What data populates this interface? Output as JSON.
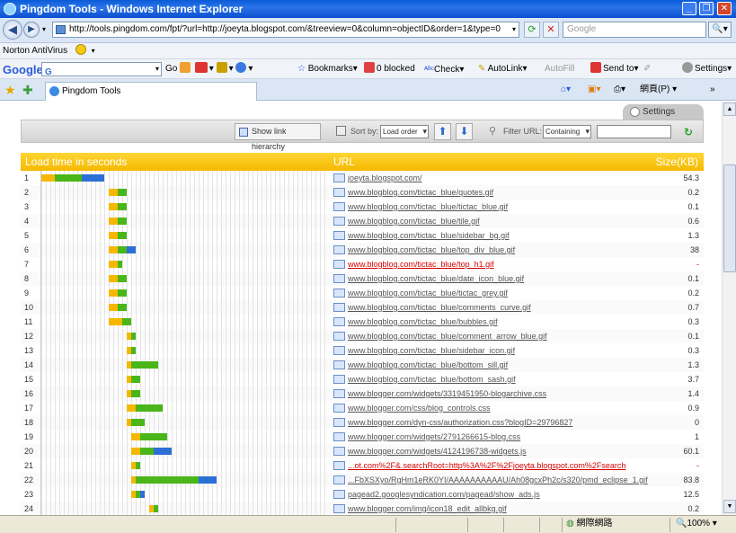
{
  "window": {
    "title": "Pingdom Tools - Windows Internet Explorer"
  },
  "nav": {
    "address": "http://tools.pingdom.com/fpt/?url=http://joeyta.blogspot.com/&treeview=0&column=objectID&order=1&type=0",
    "search_placeholder": "Google"
  },
  "norton": {
    "label": "Norton AntiVirus"
  },
  "google_toolbar": {
    "logo": "Google",
    "search_value": "G",
    "go_label": "Go",
    "bookmarks_label": "Bookmarks",
    "blocked_label": "0 blocked",
    "check_label": "Check",
    "autolink_label": "AutoLink",
    "autofill_label": "AutoFill",
    "sendto_label": "Send to",
    "settings_label": "Settings"
  },
  "tab": {
    "label": "Pingdom Tools",
    "page_label": "網頁(P)"
  },
  "tool": {
    "settings_label": "Settings",
    "hierarchy_label": "Show link hierarchy",
    "sortby_label": "Sort by:",
    "sort_value": "Load order",
    "filter_label": "Filter URL:",
    "filter_mode": "Containing"
  },
  "table": {
    "col_load": "Load time in seconds",
    "col_url": "URL",
    "col_size": "Size(KB)",
    "rows": [
      {
        "n": "1",
        "url": "joeyta.blogspot.com/",
        "size": "54.3",
        "err": false,
        "bars": [
          [
            0,
            3,
            "#f5b800"
          ],
          [
            3,
            9,
            "#4ab61a"
          ],
          [
            9,
            14,
            "#2c6fd6"
          ]
        ]
      },
      {
        "n": "2",
        "url": "www.blogblog.com/tictac_blue/quotes.gif",
        "size": "0.2",
        "err": false,
        "bars": [
          [
            15,
            17,
            "#f5b800"
          ],
          [
            17,
            19,
            "#4ab61a"
          ]
        ]
      },
      {
        "n": "3",
        "url": "www.blogblog.com/tictac_blue/tictac_blue.gif",
        "size": "0.1",
        "err": false,
        "bars": [
          [
            15,
            17,
            "#f5b800"
          ],
          [
            17,
            19,
            "#4ab61a"
          ]
        ]
      },
      {
        "n": "4",
        "url": "www.blogblog.com/tictac_blue/tile.gif",
        "size": "0.6",
        "err": false,
        "bars": [
          [
            15,
            17,
            "#f5b800"
          ],
          [
            17,
            19,
            "#4ab61a"
          ]
        ]
      },
      {
        "n": "5",
        "url": "www.blogblog.com/tictac_blue/sidebar_bg.gif",
        "size": "1.3",
        "err": false,
        "bars": [
          [
            15,
            17,
            "#f5b800"
          ],
          [
            17,
            19,
            "#4ab61a"
          ]
        ]
      },
      {
        "n": "6",
        "url": "www.blogblog.com/tictac_blue/top_div_blue.gif",
        "size": "38",
        "err": false,
        "bars": [
          [
            15,
            17,
            "#f5b800"
          ],
          [
            17,
            19,
            "#4ab61a"
          ],
          [
            19,
            21,
            "#2c6fd6"
          ]
        ]
      },
      {
        "n": "7",
        "url": "www.blogblog.com/tictac_blue/top_h1.gif",
        "size": "-",
        "err": true,
        "bars": [
          [
            15,
            17,
            "#f5b800"
          ],
          [
            17,
            18,
            "#4ab61a"
          ]
        ]
      },
      {
        "n": "8",
        "url": "www.blogblog.com/tictac_blue/date_icon_blue.gif",
        "size": "0.1",
        "err": false,
        "bars": [
          [
            15,
            17,
            "#f5b800"
          ],
          [
            17,
            19,
            "#4ab61a"
          ]
        ]
      },
      {
        "n": "9",
        "url": "www.blogblog.com/tictac_blue/tictac_grey.gif",
        "size": "0.2",
        "err": false,
        "bars": [
          [
            15,
            17,
            "#f5b800"
          ],
          [
            17,
            19,
            "#4ab61a"
          ]
        ]
      },
      {
        "n": "10",
        "url": "www.blogblog.com/tictac_blue/comments_curve.gif",
        "size": "0.7",
        "err": false,
        "bars": [
          [
            15,
            17,
            "#f5b800"
          ],
          [
            17,
            19,
            "#4ab61a"
          ]
        ]
      },
      {
        "n": "11",
        "url": "www.blogblog.com/tictac_blue/bubbles.gif",
        "size": "0.3",
        "err": false,
        "bars": [
          [
            15,
            18,
            "#f5b800"
          ],
          [
            18,
            20,
            "#4ab61a"
          ]
        ]
      },
      {
        "n": "12",
        "url": "www.blogblog.com/tictac_blue/comment_arrow_blue.gif",
        "size": "0.1",
        "err": false,
        "bars": [
          [
            19,
            20,
            "#f5b800"
          ],
          [
            20,
            21,
            "#4ab61a"
          ]
        ]
      },
      {
        "n": "13",
        "url": "www.blogblog.com/tictac_blue/sidebar_icon.gif",
        "size": "0.3",
        "err": false,
        "bars": [
          [
            19,
            20,
            "#f5b800"
          ],
          [
            20,
            21,
            "#4ab61a"
          ]
        ]
      },
      {
        "n": "14",
        "url": "www.blogblog.com/tictac_blue/bottom_sill.gif",
        "size": "1.3",
        "err": false,
        "bars": [
          [
            19,
            20,
            "#f5b800"
          ],
          [
            20,
            26,
            "#4ab61a"
          ]
        ]
      },
      {
        "n": "15",
        "url": "www.blogblog.com/tictac_blue/bottom_sash.gif",
        "size": "3.7",
        "err": false,
        "bars": [
          [
            19,
            20,
            "#f5b800"
          ],
          [
            20,
            22,
            "#4ab61a"
          ]
        ]
      },
      {
        "n": "16",
        "url": "www.blogger.com/widgets/3319451950-blogarchive.css",
        "size": "1.4",
        "err": false,
        "bars": [
          [
            19,
            20,
            "#f5b800"
          ],
          [
            20,
            22,
            "#4ab61a"
          ]
        ]
      },
      {
        "n": "17",
        "url": "www.blogger.com/css/blog_controls.css",
        "size": "0.9",
        "err": false,
        "bars": [
          [
            19,
            21,
            "#f5b800"
          ],
          [
            21,
            27,
            "#4ab61a"
          ]
        ]
      },
      {
        "n": "18",
        "url": "www.blogger.com/dyn-css/authorization.css?blogID=29796827",
        "size": "0",
        "err": false,
        "bars": [
          [
            19,
            20,
            "#f5b800"
          ],
          [
            20,
            23,
            "#4ab61a"
          ]
        ]
      },
      {
        "n": "19",
        "url": "www.blogger.com/widgets/2791266615-blog.css",
        "size": "1",
        "err": false,
        "bars": [
          [
            20,
            22,
            "#f5b800"
          ],
          [
            22,
            28,
            "#4ab61a"
          ]
        ]
      },
      {
        "n": "20",
        "url": "www.blogger.com/widgets/4124196738-widgets.js",
        "size": "60.1",
        "err": false,
        "bars": [
          [
            20,
            22,
            "#f5b800"
          ],
          [
            22,
            25,
            "#4ab61a"
          ],
          [
            25,
            29,
            "#2c6fd6"
          ]
        ]
      },
      {
        "n": "21",
        "url": "...ot.com%2F&.searchRoot=http%3A%2F%2Fjoeyta.blogspot.com%2Fsearch",
        "size": "-",
        "err": true,
        "bars": [
          [
            20,
            21,
            "#f5b800"
          ],
          [
            21,
            22,
            "#4ab61a"
          ]
        ]
      },
      {
        "n": "22",
        "url": "...FbXSXyo/RgHm1eRK0YI/AAAAAAAAAAU/Ah08gcxPh2c/s320/pmd_eclipse_1.gif",
        "size": "83.8",
        "err": false,
        "bars": [
          [
            20,
            21,
            "#f5b800"
          ],
          [
            21,
            35,
            "#4ab61a"
          ],
          [
            35,
            39,
            "#2c6fd6"
          ]
        ]
      },
      {
        "n": "23",
        "url": "pagead2.googlesyndication.com/pagead/show_ads.js",
        "size": "12.5",
        "err": false,
        "bars": [
          [
            20,
            21,
            "#f5b800"
          ],
          [
            21,
            22,
            "#4ab61a"
          ],
          [
            22,
            23,
            "#2c6fd6"
          ]
        ]
      },
      {
        "n": "24",
        "url": "www.blogger.com/img/icon18_edit_allbkg.gif",
        "size": "0.2",
        "err": false,
        "bars": [
          [
            24,
            25,
            "#f5b800"
          ],
          [
            25,
            26,
            "#4ab61a"
          ]
        ]
      }
    ]
  },
  "status": {
    "zone": "網際網路",
    "zoom": "100%"
  }
}
